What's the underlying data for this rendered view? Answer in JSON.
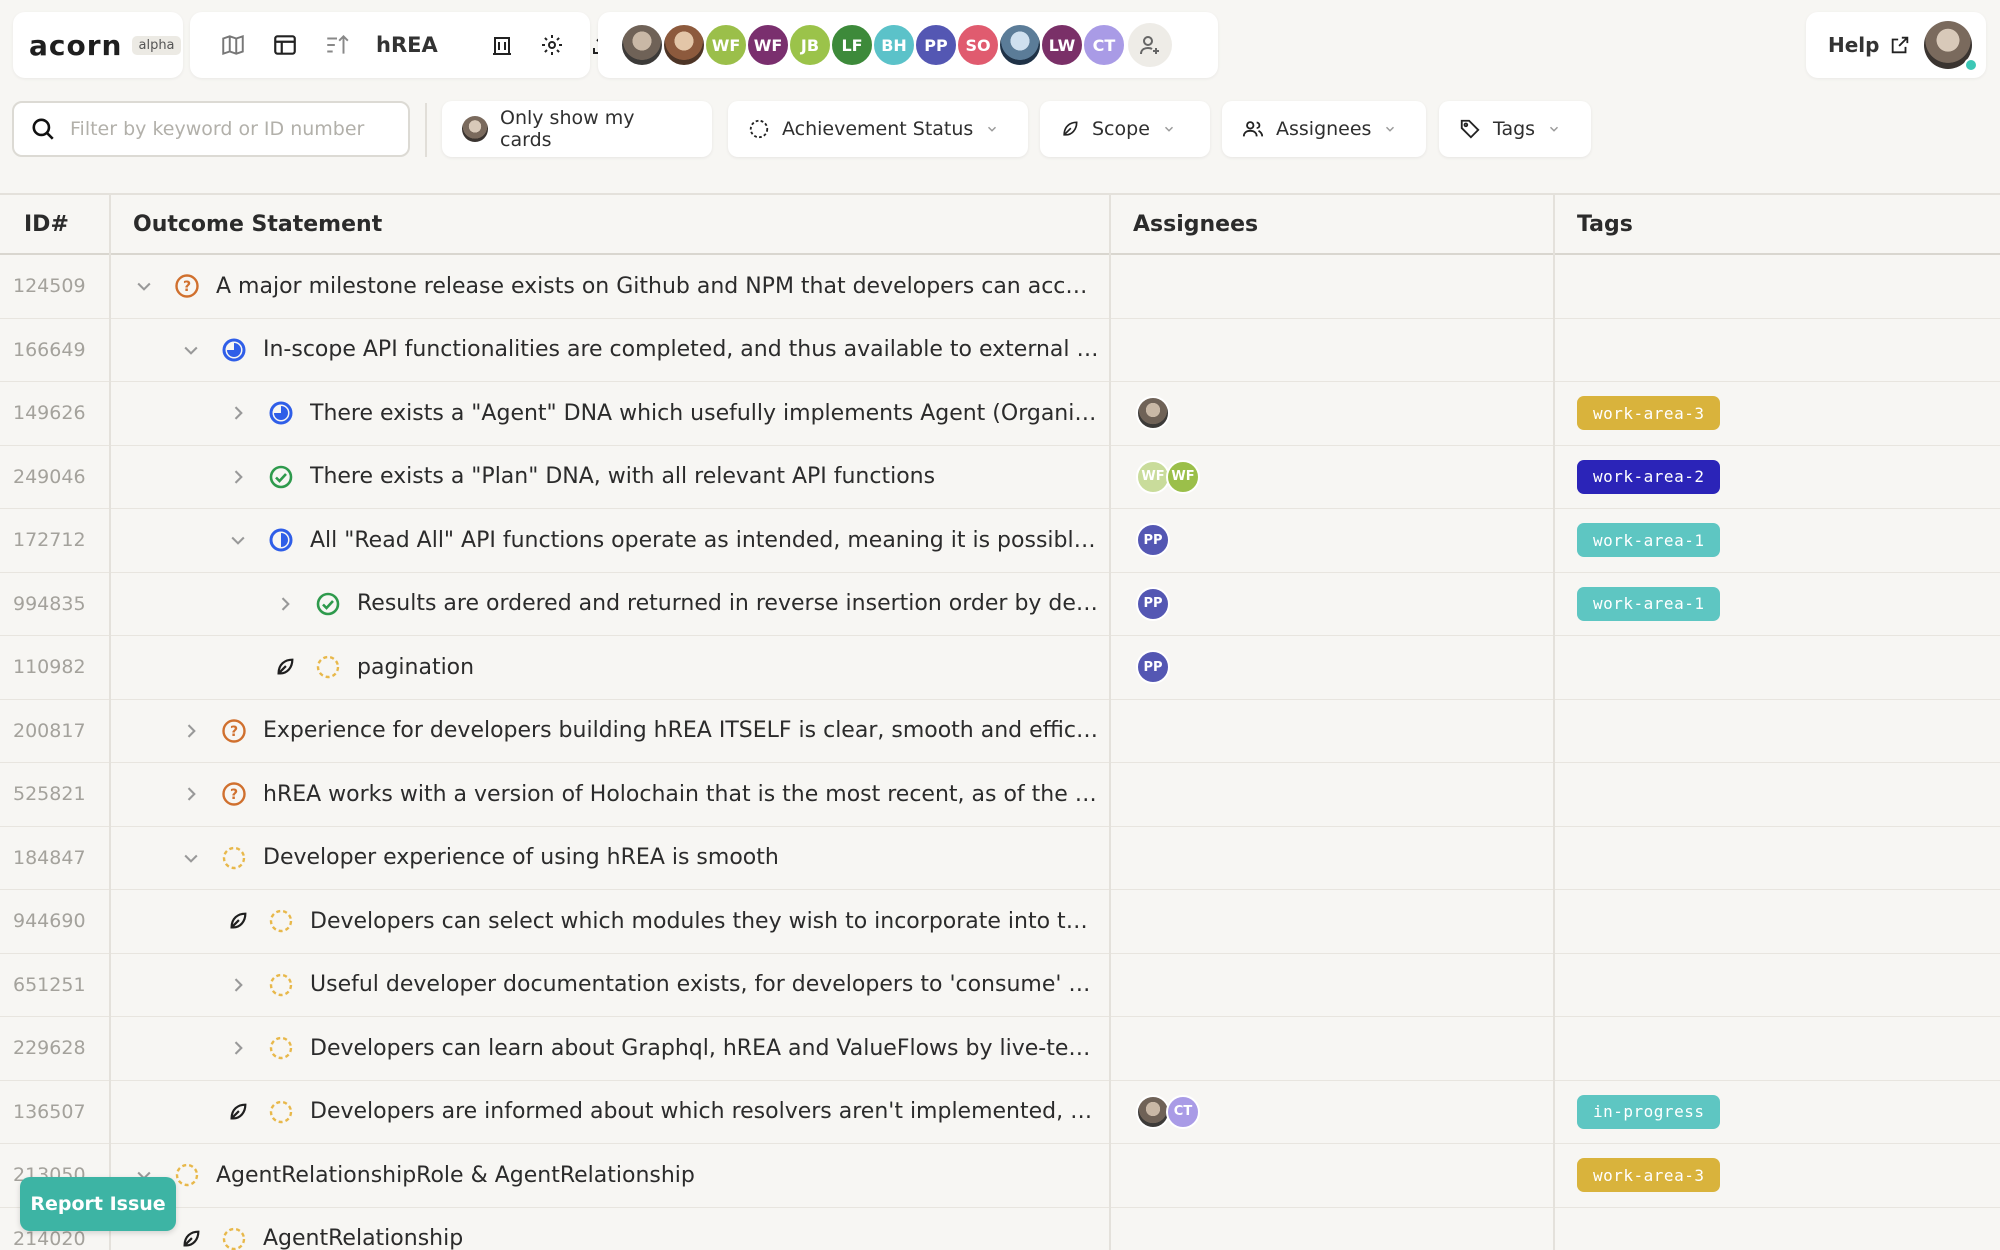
{
  "app": {
    "logo": "acorn",
    "badge": "alpha",
    "project_name": "hREA"
  },
  "toolbar": {
    "icons": [
      "map-icon",
      "table-icon",
      "sort-icon",
      "bank-icon",
      "gear-icon",
      "upload-icon"
    ]
  },
  "members": [
    {
      "kind": "photo"
    },
    {
      "kind": "photo2"
    },
    {
      "initials": "WF",
      "color": "#9bbf4a"
    },
    {
      "initials": "WF",
      "color": "#7a2f6e"
    },
    {
      "initials": "JB",
      "color": "#9bc34a"
    },
    {
      "initials": "LF",
      "color": "#3d8a3a"
    },
    {
      "initials": "BH",
      "color": "#5bc2c9"
    },
    {
      "initials": "PP",
      "color": "#5457b3"
    },
    {
      "initials": "SO",
      "color": "#e05b6f"
    },
    {
      "kind": "photo3"
    },
    {
      "initials": "LW",
      "color": "#7a3068"
    },
    {
      "initials": "CT",
      "color": "#a99be6"
    }
  ],
  "help": {
    "label": "Help"
  },
  "filters": {
    "search_placeholder": "Filter by keyword or ID number",
    "only_mine": "Only show my cards",
    "achievement": "Achievement Status",
    "scope": "Scope",
    "assignees": "Assignees",
    "tags": "Tags"
  },
  "columns": {
    "id": "ID#",
    "outcome": "Outcome Statement",
    "assignees": "Assignees",
    "tags": "Tags"
  },
  "rows": [
    {
      "id": "124509",
      "depth": 0,
      "toggle": "down",
      "status": "uncertain",
      "text": "A major milestone release exists on Github and NPM that developers can access to...",
      "assignees": [],
      "tags": []
    },
    {
      "id": "166649",
      "depth": 1,
      "toggle": "down",
      "status": "partial",
      "text": "In-scope API functionalities are completed, and thus available to external dev...",
      "assignees": [],
      "tags": []
    },
    {
      "id": "149626",
      "depth": 2,
      "toggle": "right",
      "status": "partial",
      "text": "There exists a \"Agent\" DNA which usefully implements Agent (Organizatio...",
      "assignees": [
        {
          "kind": "photo"
        }
      ],
      "tags": [
        {
          "label": "work-area-3",
          "color": "#d9b33c"
        }
      ]
    },
    {
      "id": "249046",
      "depth": 2,
      "toggle": "right",
      "status": "achieved",
      "text": "There exists a \"Plan\" DNA, with all relevant API functions",
      "assignees": [
        {
          "initials": "WF",
          "color": "#c9dc9b"
        },
        {
          "initials": "WF",
          "color": "#9bbf4a"
        }
      ],
      "tags": [
        {
          "label": "work-area-2",
          "color": "#2b24b8"
        }
      ]
    },
    {
      "id": "172712",
      "depth": 2,
      "toggle": "down",
      "status": "partial-small",
      "text": "All \"Read All\" API functions operate as intended, meaning it is possible to ...",
      "assignees": [
        {
          "initials": "PP",
          "color": "#5457b3"
        }
      ],
      "tags": [
        {
          "label": "work-area-1",
          "color": "#5ec6c2"
        }
      ]
    },
    {
      "id": "994835",
      "depth": 3,
      "toggle": "right",
      "status": "achieved",
      "text": "Results are ordered and returned in reverse insertion order by default",
      "assignees": [
        {
          "initials": "PP",
          "color": "#5457b3"
        }
      ],
      "tags": [
        {
          "label": "work-area-1",
          "color": "#5ec6c2"
        }
      ]
    },
    {
      "id": "110982",
      "depth": 3,
      "toggle": "leaf",
      "status": "not-achieved",
      "text": "pagination",
      "assignees": [
        {
          "initials": "PP",
          "color": "#5457b3"
        }
      ],
      "tags": []
    },
    {
      "id": "200817",
      "depth": 1,
      "toggle": "right",
      "status": "uncertain",
      "text": "Experience for developers building hREA ITSELF is clear, smooth and efficient",
      "assignees": [],
      "tags": []
    },
    {
      "id": "525821",
      "depth": 1,
      "toggle": "right",
      "status": "uncertain",
      "text": "hREA works with a version of Holochain that is the most recent, as of the mid-...",
      "assignees": [],
      "tags": []
    },
    {
      "id": "184847",
      "depth": 1,
      "toggle": "down",
      "status": "not-achieved",
      "text": "Developer experience of using hREA is smooth",
      "assignees": [],
      "tags": []
    },
    {
      "id": "944690",
      "depth": 2,
      "toggle": "leaf",
      "status": "not-achieved",
      "text": "Developers can select which modules they wish to incorporate into their ...",
      "assignees": [],
      "tags": []
    },
    {
      "id": "651251",
      "depth": 2,
      "toggle": "right",
      "status": "not-achieved",
      "text": "Useful developer documentation exists, for developers to 'consume' hREA",
      "assignees": [],
      "tags": []
    },
    {
      "id": "229628",
      "depth": 2,
      "toggle": "right",
      "status": "not-achieved",
      "text": "Developers can learn about Graphql, hREA and ValueFlows by live-testin...",
      "assignees": [],
      "tags": []
    },
    {
      "id": "136507",
      "depth": 2,
      "toggle": "leaf",
      "status": "not-achieved",
      "text": "Developers are informed about which resolvers aren't implemented, and ...",
      "assignees": [
        {
          "kind": "photo"
        },
        {
          "initials": "CT",
          "color": "#a99be6"
        }
      ],
      "tags": [
        {
          "label": "in-progress",
          "color": "#5ec6c2"
        }
      ]
    },
    {
      "id": "213050",
      "depth": 0,
      "toggle": "down",
      "status": "not-achieved",
      "text": "AgentRelationshipRole & AgentRelationship",
      "assignees": [],
      "tags": [
        {
          "label": "work-area-3",
          "color": "#d9b33c"
        }
      ]
    },
    {
      "id": "214020",
      "depth": 1,
      "toggle": "leaf",
      "status": "not-achieved",
      "text": "AgentRelationship",
      "assignees": [],
      "tags": []
    }
  ],
  "report": {
    "label": "Report Issue"
  }
}
